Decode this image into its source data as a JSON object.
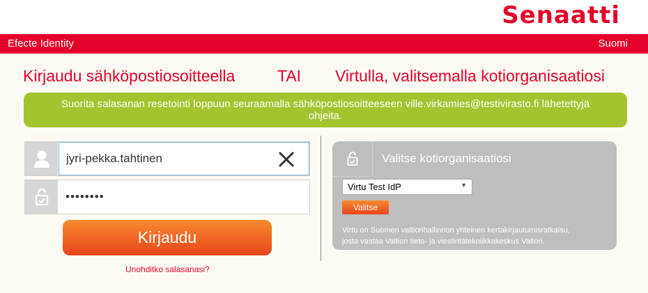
{
  "header": {
    "logo_text": "Senaatti",
    "app_name": "Efecte Identity",
    "language": "Suomi"
  },
  "headings": {
    "email_login": "Kirjaudu sähköpostiosoitteella",
    "or": "TAI",
    "virtu_login": "Virtulla, valitsemalla kotiorganisaatiosi"
  },
  "notice": {
    "line1": "Suorita salasanan resetointi loppuun seuraamalla sähköpostiosoitteeseen ville.virkamies@testivirasto.fi lähetettyjä",
    "line2": "ohjeita."
  },
  "login_form": {
    "username_value": "jyri-pekka.tahtinen",
    "password_value": "••••••••",
    "login_button": "Kirjaudu",
    "forgot_password": "Unohditko salasanasi?"
  },
  "virtu": {
    "title": "Valitse kotiorganisaatiosi",
    "selected_org": "Virtu Test IdP",
    "choose_button": "Valitse",
    "description_line1": "Virtu on Suomen valtionhallinnon yhteinen kertakirjautumisratkaisu,",
    "description_line2": "josta vastaa Valtion tieto- ja viestintätekniikkakeskus Valtori."
  },
  "icons": {
    "user": "user-icon",
    "lock": "lock-icon",
    "clear": "close-icon",
    "dropdown": "chevron-down-icon"
  },
  "colors": {
    "brand_red": "#e4002b",
    "notice_green": "#a3c42f",
    "button_orange": "#f06a24",
    "panel_gray": "#bebebe"
  }
}
